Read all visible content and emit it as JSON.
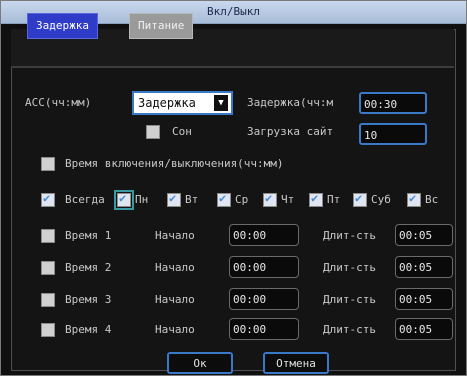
{
  "window": {
    "title": "Вкл/Выкл"
  },
  "tabs": [
    {
      "label": "Задержка",
      "active": true
    },
    {
      "label": "Питание",
      "active": false
    }
  ],
  "acc": {
    "label": "ACC(чч:мм)",
    "select_value": "Задержка",
    "delay_label": "Задержка(чч:мм)",
    "delay_label_visible": "Задержка(чч:м",
    "delay_value": "00:30"
  },
  "sleep": {
    "label": "Сон",
    "checked": false
  },
  "upload": {
    "label": "Загрузка сайт",
    "value": "10"
  },
  "schedule": {
    "label": "Время включения/выключения(чч:мм)",
    "checked": false
  },
  "days": {
    "always": {
      "label": "Всегда",
      "checked": true
    },
    "items": [
      {
        "label": "Пн",
        "checked": true
      },
      {
        "label": "Вт",
        "checked": true
      },
      {
        "label": "Ср",
        "checked": true
      },
      {
        "label": "Чт",
        "checked": true
      },
      {
        "label": "Пт",
        "checked": true
      },
      {
        "label": "Суб",
        "checked": true
      },
      {
        "label": "Вс",
        "checked": true
      }
    ]
  },
  "times": [
    {
      "label": "Время 1",
      "start_label": "Начало",
      "start": "00:00",
      "duration_label": "Длит-сть",
      "duration": "00:05",
      "checked": false
    },
    {
      "label": "Время 2",
      "start_label": "Начало",
      "start": "00:00",
      "duration_label": "Длит-сть",
      "duration": "00:05",
      "checked": false
    },
    {
      "label": "Время 3",
      "start_label": "Начало",
      "start": "00:00",
      "duration_label": "Длит-сть",
      "duration": "00:05",
      "checked": false
    },
    {
      "label": "Время 4",
      "start_label": "Начало",
      "start": "00:00",
      "duration_label": "Длит-сть",
      "duration": "00:05",
      "checked": false
    }
  ],
  "buttons": {
    "ok": "Ок",
    "cancel": "Отмена"
  },
  "icons": {
    "dropdown": "chevron-down-icon"
  }
}
